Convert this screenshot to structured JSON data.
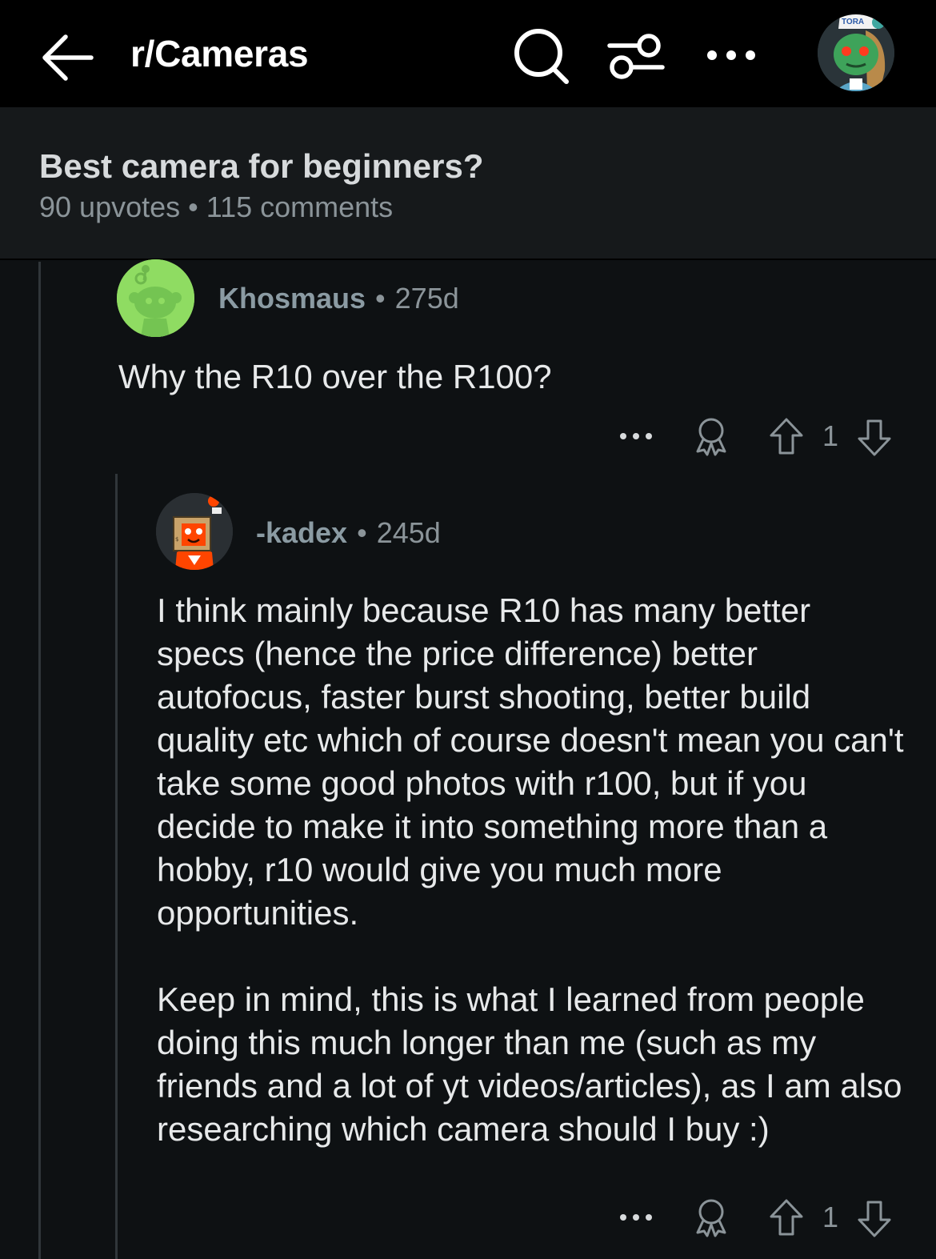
{
  "nav": {
    "subreddit": "r/Cameras",
    "icons": [
      "back-arrow-icon",
      "search-icon",
      "filter-icon",
      "more-icon",
      "user-avatar"
    ]
  },
  "post": {
    "title": "Best camera for beginners?",
    "meta": "90 upvotes • 115 comments"
  },
  "comments": [
    {
      "author": "Khosmaus",
      "age": "275d",
      "body": "Why the R10 over the R100?",
      "votes": "1"
    },
    {
      "author": "-kadex",
      "age": "245d",
      "paragraphs": [
        "I think mainly because R10 has many better specs (hence the price difference) better autofocus, faster burst shooting, better build quality etc which of course doesn't mean you can't take some good photos with r100, but if you decide to make it into something more than a hobby, r10 would give you much more opportunities.",
        "Keep in mind, this is what I learned from people doing this much longer than me (such as my friends and a lot of yt videos/articles), as I am also researching which camera should I buy :)"
      ],
      "votes": "1"
    }
  ],
  "avatar_text": "TORA",
  "colors": {
    "background": "#0e1113",
    "topbar": "#000000",
    "header": "#16191b",
    "thread_line": "#30363a",
    "text_primary": "#e7e9ea",
    "text_muted": "#8b9499",
    "avatar_green": "#8fdc62"
  }
}
